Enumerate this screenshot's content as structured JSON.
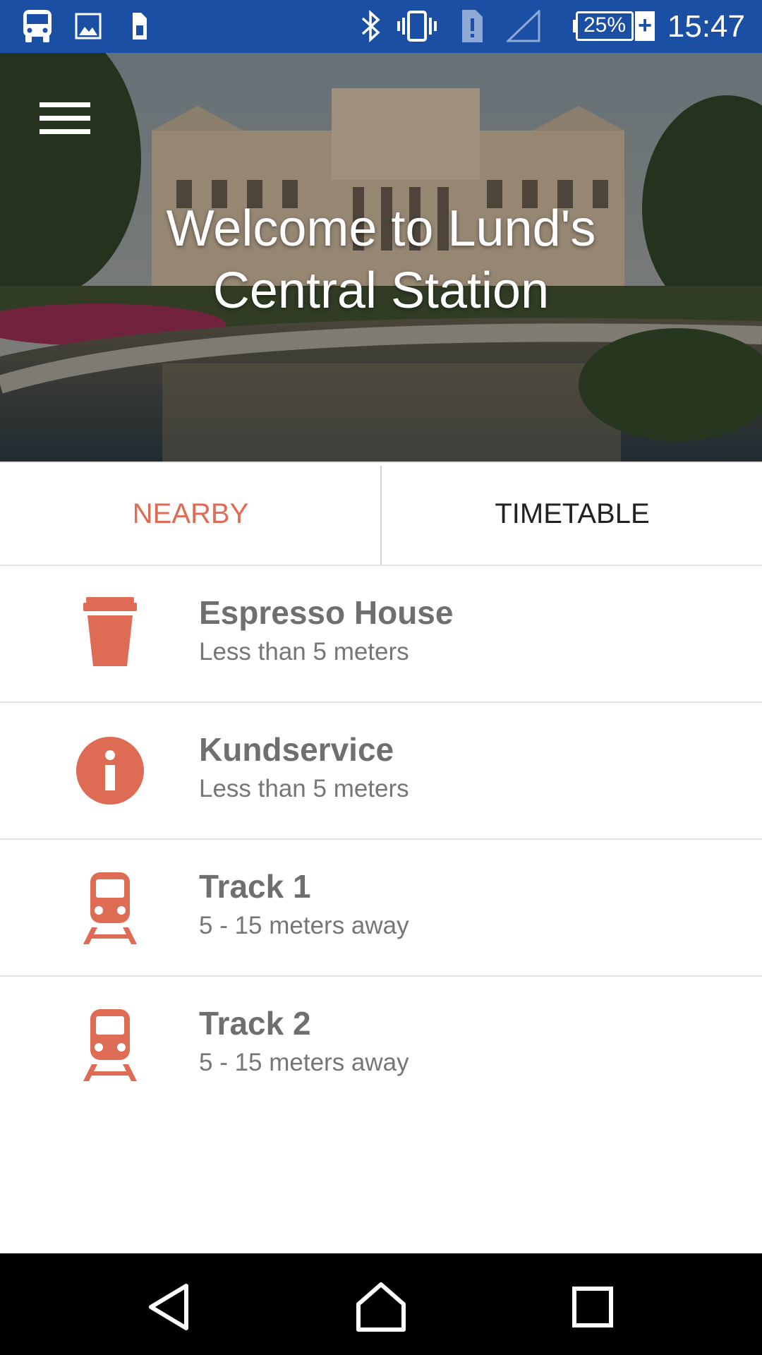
{
  "status_bar": {
    "time": "15:47",
    "battery_percent": "25%",
    "battery_charging_glyph": "+",
    "left_icons": [
      "bus-icon",
      "image-icon",
      "sim-card-icon"
    ],
    "right_icons": [
      "bluetooth-icon",
      "vibrate-icon",
      "sim-alert-icon",
      "signal-icon",
      "battery-icon"
    ],
    "background_color": "#1b4fa3"
  },
  "hero": {
    "title": "Welcome to Lund's Central Station",
    "menu_icon": "hamburger-menu-icon"
  },
  "tabs": [
    {
      "label": "NEARBY",
      "active": true
    },
    {
      "label": "TIMETABLE",
      "active": false
    }
  ],
  "accent_color": "#de6b54",
  "nearby": [
    {
      "title": "Espresso House",
      "distance": "Less than 5 meters",
      "icon": "coffee-cup-icon"
    },
    {
      "title": "Kundservice",
      "distance": "Less than 5 meters",
      "icon": "info-icon"
    },
    {
      "title": "Track 1",
      "distance": "5 - 15 meters away",
      "icon": "train-icon"
    },
    {
      "title": "Track 2",
      "distance": "5 - 15 meters away",
      "icon": "train-icon"
    }
  ],
  "nav_bar": {
    "buttons": [
      "back-icon",
      "home-icon",
      "recents-icon"
    ]
  }
}
